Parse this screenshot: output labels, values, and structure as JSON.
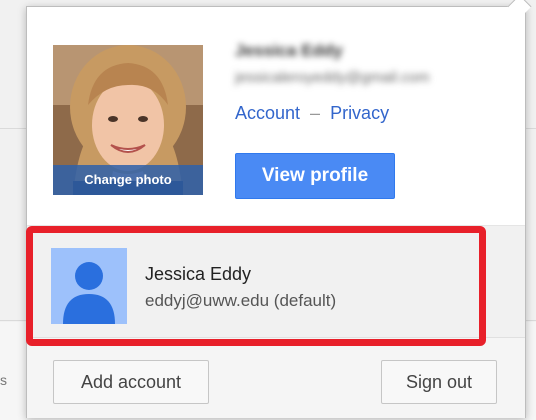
{
  "profile": {
    "name": "Jessica Eddy",
    "email": "jessicaleroyeddy@gmail.com",
    "change_photo_label": "Change photo",
    "account_link": "Account",
    "separator": "–",
    "privacy_link": "Privacy",
    "view_profile_label": "View profile"
  },
  "accounts": [
    {
      "name": "Jessica Eddy",
      "email": "eddyj@uww.edu (default)"
    }
  ],
  "footer": {
    "add_account_label": "Add account",
    "sign_out_label": "Sign out"
  },
  "background": {
    "edge_char": "s"
  },
  "colors": {
    "highlight": "#e8202a",
    "primary_button": "#4a8af4",
    "link": "#3366cc",
    "avatar_bg": "#9dc1fb",
    "avatar_fg": "#2a6fde"
  },
  "icons": {
    "avatar": "person-silhouette-icon"
  }
}
